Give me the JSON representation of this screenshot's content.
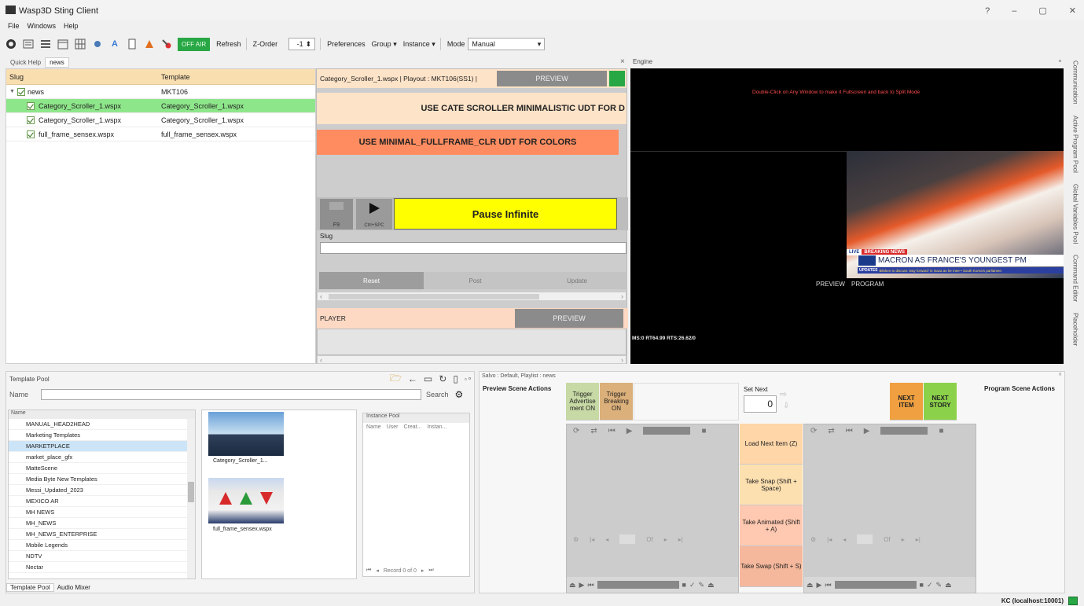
{
  "window": {
    "title": "Wasp3D Sting Client",
    "controls": [
      "?",
      "–",
      "▢",
      "✕"
    ]
  },
  "menu": [
    "File",
    "Windows",
    "Help"
  ],
  "toolbar": {
    "off_air": "OFF AIR",
    "refresh": "Refresh",
    "zorder": "Z-Order",
    "zorder_value": "-1",
    "preferences": "Preferences",
    "group": "Group",
    "instance": "Instance",
    "mode_label": "Mode",
    "mode_value": "Manual"
  },
  "doc_tabs": [
    "Quick Help",
    "news"
  ],
  "playlist": {
    "columns": [
      "Slug",
      "Template"
    ],
    "group": {
      "name": "news",
      "template": "MKT106"
    },
    "rows": [
      {
        "slug": "Category_Scroller_1.wspx",
        "template": "Category_Scroller_1.wspx",
        "selected": true
      },
      {
        "slug": "Category_Scroller_1.wspx",
        "template": "Category_Scroller_1.wspx",
        "selected": false
      },
      {
        "slug": "full_frame_sensex.wspx",
        "template": "full_frame_sensex.wspx",
        "selected": false
      }
    ]
  },
  "editor": {
    "header": "Category_Scroller_1.wspx | Playout : MKT106(SS1) |",
    "preview": "PREVIEW",
    "notice1": "USE CATE SCROLLER MINIMALISTIC UDT FOR D",
    "notice2": "USE MINIMAL_FULLFRAME_CLR UDT FOR COLORS",
    "f9": "F9",
    "ctrl_space": "Ctrl+SPC",
    "pause": "Pause Infinite",
    "slug_label": "Slug",
    "reset": "Reset",
    "post": "Post",
    "update": "Update",
    "player": "PLAYER",
    "player_preview": "PREVIEW"
  },
  "engine": {
    "title": "Engine",
    "hint": "Double-Click on Any Window to make it Fullscreen and back to Split Mode",
    "preview": "PREVIEW",
    "program": "PROGRAM",
    "stats": "MS:0 RT64.99 RTS:26.62/0",
    "live": "LIVE",
    "breaking": "BREAKING NEWS",
    "headline": "MACRON AS FRANCE'S YOUNGEST PM",
    "updates": "UPDATES",
    "ticker": "Blinken to discuss 'way forward' in Gaza as he mee  •  South Korea's parliamen"
  },
  "side_tabs": [
    "Communication",
    "Active Program Pool",
    "Global Variables Pool",
    "Command Editor",
    "Placeholder"
  ],
  "template_pool": {
    "title": "Template Pool",
    "name_label": "Name",
    "search": "Search",
    "tree_header": "Name",
    "tree": [
      "MANUAL_HEAD2HEAD",
      "Marketing Templates",
      "MARKETPLACE",
      "market_place_gfx",
      "MatteScene",
      "Media Byte New Templates",
      "Messi_Updated_2023",
      "MEXICO AR",
      "MH NEWS",
      "MH_NEWS",
      "MH_NEWS_ENTERPRISE",
      "Mobile Legends",
      "NDTV",
      "Nectar"
    ],
    "thumbs": [
      "Category_Scroller_1...",
      "full_frame_sensex.wspx"
    ],
    "instance_pool": "Instance Pool",
    "instance_cols": [
      "Name",
      "User",
      "Creat...",
      "Instan..."
    ],
    "record": "Record 0 of 0",
    "tabs": [
      "Template Pool",
      "Audio Mixer"
    ]
  },
  "salvo": {
    "header": "Salvo : Default, Playlist : news",
    "preview_actions": "Preview Scene Actions",
    "program_actions": "Program Scene Actions",
    "trigger1": "Trigger Advertise ment ON",
    "trigger2": "Trigger Breaking ON",
    "set_next": "Set Next",
    "set_next_value": "0",
    "next_item": "NEXT ITEM",
    "next_story": "NEXT STORY",
    "load_next": "Load Next Item (Z)",
    "take_snap": "Take Snap (Shift + Space)",
    "take_animated": "Take Animated (Shift + A)",
    "take_swap": "Take Swap (Shift + S)",
    "of": "Of"
  },
  "status": {
    "server": "KC (localhost:10001)"
  },
  "colors": {
    "offair": "#28a745",
    "selected_row": "#8ee68a",
    "orange": "#ff8c60",
    "yellow": "#ffff00",
    "peach": "#ffd9c4",
    "green_btn": "#8bd14a",
    "orange_btn": "#f0a040"
  }
}
